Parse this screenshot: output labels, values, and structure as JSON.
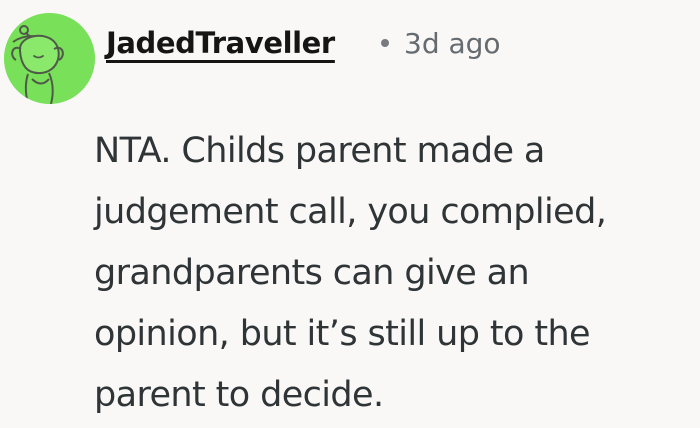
{
  "comment": {
    "username": "JadedTraveller",
    "separator": "•",
    "timestamp": "3d ago",
    "body_lines": [
      "NTA. Childs parent made a",
      "judgement call, you complied,",
      "grandparents can give an",
      "opinion, but it’s still up to the",
      "parent to decide."
    ]
  },
  "avatar": {
    "icon": "reddit-snoo-avatar",
    "background_color": "#79e05a",
    "line_color": "#4f5a48",
    "face_color": "#8ae96b"
  },
  "colors": {
    "background": "#f9f8f7",
    "username": "#151515",
    "timestamp": "#666b70",
    "body": "#2f3437"
  }
}
